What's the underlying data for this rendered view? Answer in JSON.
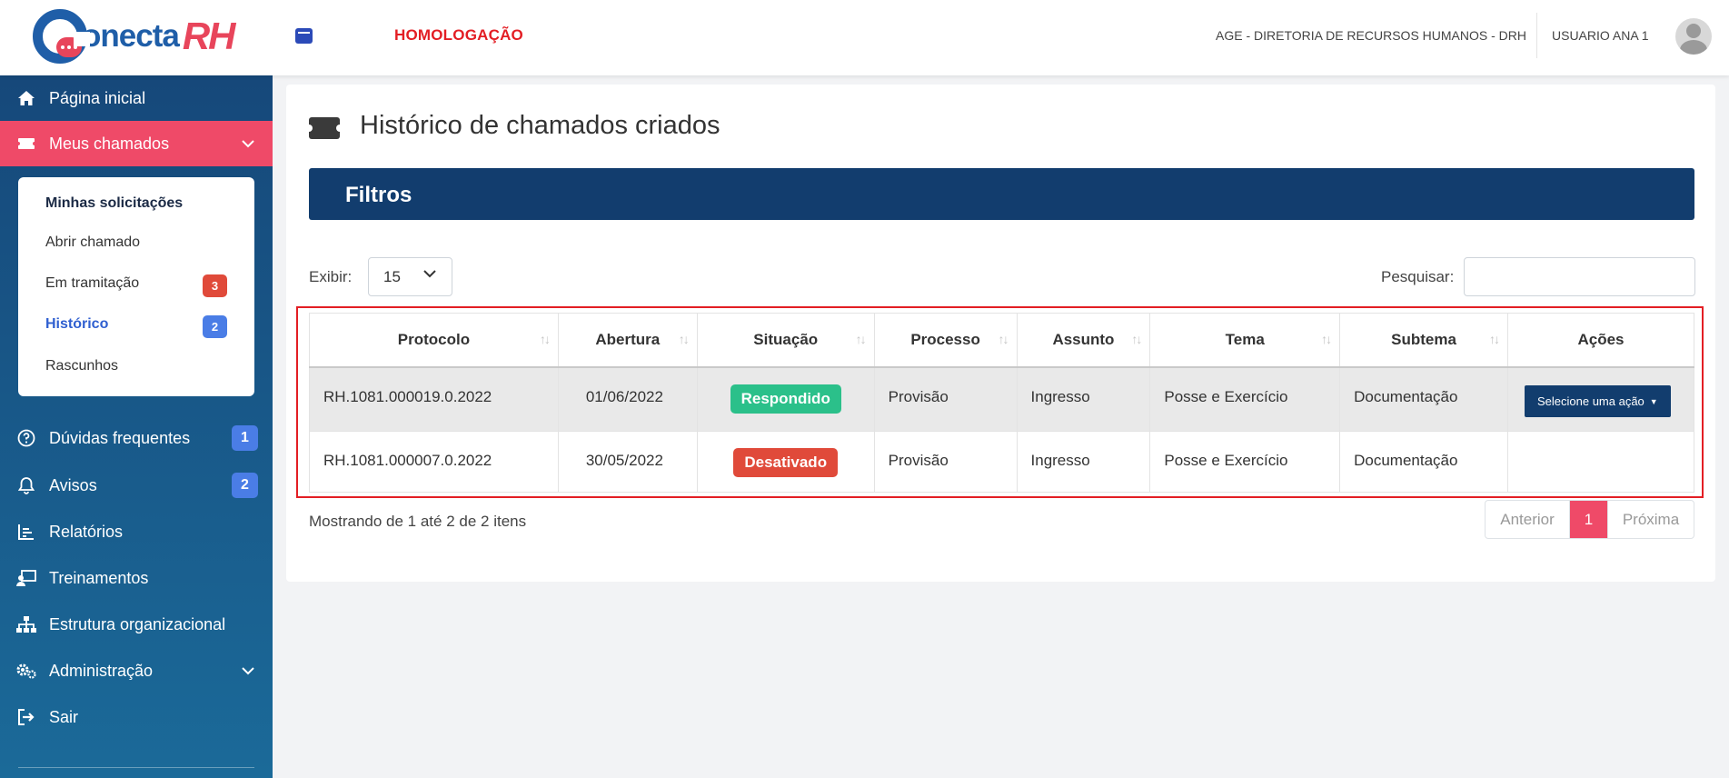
{
  "header": {
    "logo_text": "onecta",
    "logo_rh": "RH",
    "environment": "HOMOLOGAÇÃO",
    "organization": "AGE - DIRETORIA DE RECURSOS HUMANOS - DRH",
    "user": "USUARIO ANA 1"
  },
  "sidebar": {
    "items": [
      {
        "label": "Página inicial",
        "icon": "home-icon"
      },
      {
        "label": "Meus chamados",
        "icon": "ticket-icon"
      },
      {
        "label": "Dúvidas frequentes",
        "icon": "question-icon",
        "badge": "1"
      },
      {
        "label": "Avisos",
        "icon": "bell-icon",
        "badge": "2"
      },
      {
        "label": "Relatórios",
        "icon": "chart-icon"
      },
      {
        "label": "Treinamentos",
        "icon": "training-icon"
      },
      {
        "label": "Estrutura organizacional",
        "icon": "sitemap-icon"
      },
      {
        "label": "Administração",
        "icon": "gears-icon"
      },
      {
        "label": "Sair",
        "icon": "sign-out-icon"
      }
    ],
    "submenu": {
      "title": "Minhas solicitações",
      "items": [
        {
          "label": "Abrir chamado"
        },
        {
          "label": "Em tramitação",
          "badge": "3",
          "badge_color": "#e04a3a"
        },
        {
          "label": "Histórico",
          "badge": "2",
          "badge_color": "#4a7de6"
        },
        {
          "label": "Rascunhos"
        }
      ]
    }
  },
  "main": {
    "title": "Histórico de chamados criados",
    "filters_label": "Filtros",
    "show_label": "Exibir:",
    "show_value": "15",
    "search_label": "Pesquisar:",
    "search_value": "",
    "columns": [
      "Protocolo",
      "Abertura",
      "Situação",
      "Processo",
      "Assunto",
      "Tema",
      "Subtema",
      "Ações"
    ],
    "rows": [
      {
        "protocolo": "RH.1081.000019.0.2022",
        "abertura": "01/06/2022",
        "situacao": "Respondido",
        "situacao_color": "#2bc08a",
        "processo": "Provisão",
        "assunto": "Ingresso",
        "tema": "Posse e Exercício",
        "subtema": "Documentação",
        "acao": "Selecione uma ação"
      },
      {
        "protocolo": "RH.1081.000007.0.2022",
        "abertura": "30/05/2022",
        "situacao": "Desativado",
        "situacao_color": "#e04a3a",
        "processo": "Provisão",
        "assunto": "Ingresso",
        "tema": "Posse e Exercício",
        "subtema": "Documentação",
        "acao": ""
      }
    ],
    "info": "Mostrando de 1 até 2 de 2 itens",
    "pagination": {
      "prev": "Anterior",
      "current": "1",
      "next": "Próxima"
    }
  },
  "colors": {
    "primary": "#123d6e",
    "accent": "#ef4a68",
    "env": "#e31e24"
  }
}
